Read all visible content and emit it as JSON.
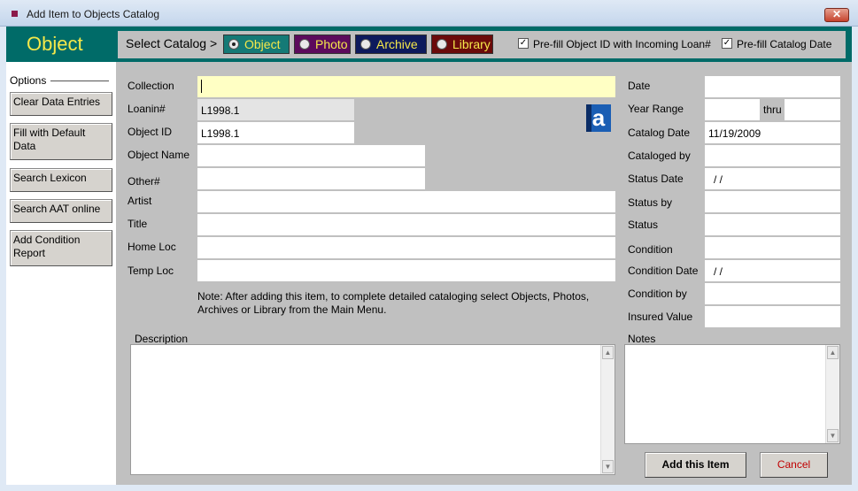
{
  "window": {
    "title": "Add Item to Objects Catalog",
    "close_glyph": "✕"
  },
  "header": {
    "title": "Object",
    "select_catalog_label": "Select Catalog >",
    "catalogs": [
      {
        "label": "Object",
        "selected": true
      },
      {
        "label": "Photo",
        "selected": false
      },
      {
        "label": "Archive",
        "selected": false
      },
      {
        "label": "Library",
        "selected": false
      }
    ],
    "prefill_id": {
      "label": "Pre-fill Object ID with Incoming Loan#",
      "checked": true
    },
    "prefill_date": {
      "label": "Pre-fill Catalog Date",
      "checked": true
    }
  },
  "sidebar": {
    "options_label": "Options",
    "buttons": [
      "Clear Data Entries",
      "Fill with Default Data",
      "Search Lexicon",
      "Search AAT online",
      "Add Condition Report"
    ]
  },
  "form": {
    "collection": {
      "label": "Collection",
      "value": ""
    },
    "loanin": {
      "label": "Loanin#",
      "value": "L1998.1"
    },
    "object_id": {
      "label": "Object ID",
      "value": "L1998.1"
    },
    "object_name": {
      "label": "Object Name",
      "value": ""
    },
    "other": {
      "label": "Other#",
      "value": ""
    },
    "artist": {
      "label": "Artist",
      "value": ""
    },
    "title": {
      "label": "Title",
      "value": ""
    },
    "home_loc": {
      "label": "Home Loc",
      "value": ""
    },
    "temp_loc": {
      "label": "Temp Loc",
      "value": ""
    },
    "note": "Note: After adding this item, to complete detailed cataloging select Objects, Photos, Archives or Library from the Main Menu.",
    "description": {
      "label": "Description",
      "value": ""
    },
    "date": {
      "label": "Date",
      "value": ""
    },
    "year_range": {
      "label": "Year Range",
      "from": "",
      "thru_label": "thru",
      "to": ""
    },
    "catalog_date": {
      "label": "Catalog Date",
      "value": "11/19/2009"
    },
    "cataloged_by": {
      "label": "Cataloged by",
      "value": ""
    },
    "status_date": {
      "label": "Status Date",
      "value": "/ /"
    },
    "status_by": {
      "label": "Status by",
      "value": ""
    },
    "status": {
      "label": "Status",
      "value": ""
    },
    "condition": {
      "label": "Condition",
      "value": ""
    },
    "condition_date": {
      "label": "Condition Date",
      "value": "/ /"
    },
    "condition_by": {
      "label": "Condition by",
      "value": ""
    },
    "insured_value": {
      "label": "Insured Value",
      "value": ""
    },
    "notes": {
      "label": "Notes",
      "value": ""
    },
    "lexicon_icon_glyph": "a"
  },
  "actions": {
    "add_label": "Add this Item",
    "cancel_label": "Cancel"
  },
  "colors": {
    "header_teal": "#006b68",
    "header_title": "#f5e84a",
    "panel_gray": "#c0c0c0",
    "collection_yellow": "#ffffc4",
    "cancel_red": "#c00000"
  }
}
